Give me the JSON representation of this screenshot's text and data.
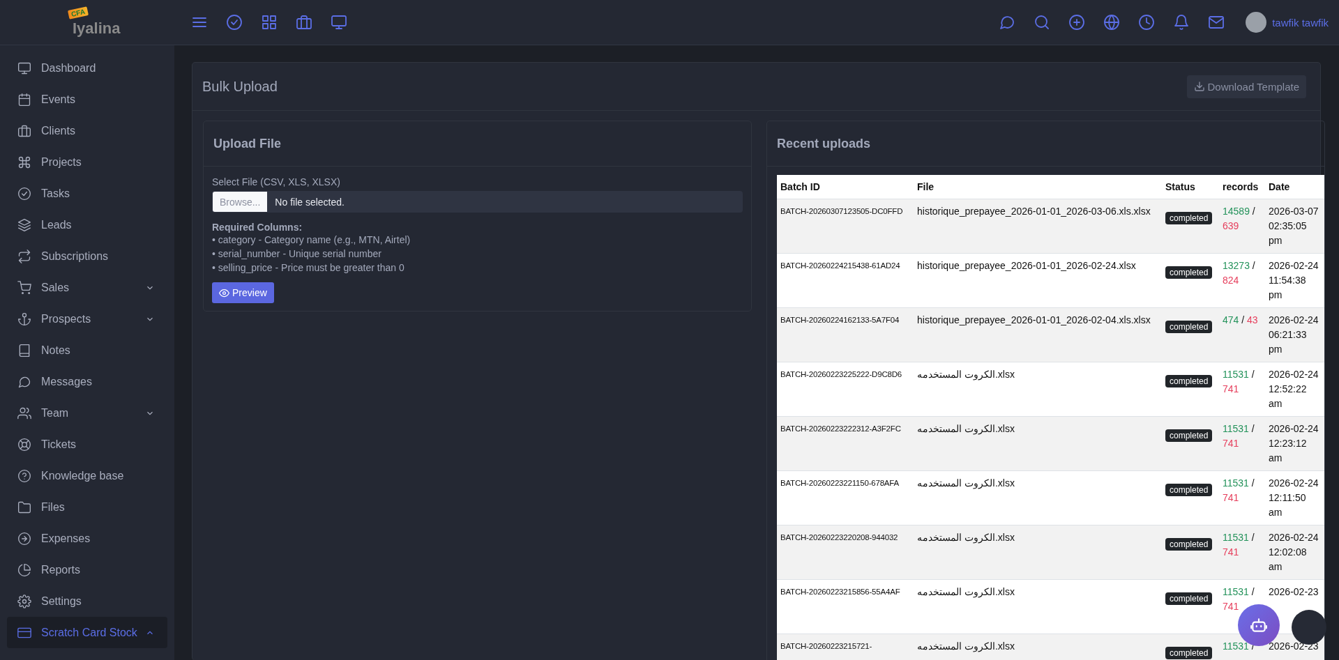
{
  "logo": {
    "badge": "CFA",
    "name": "Iyalina"
  },
  "user": {
    "name": "tawfik tawfik"
  },
  "sidebar": {
    "items": [
      {
        "label": "Dashboard",
        "kind": "link",
        "selected": false
      },
      {
        "label": "Events",
        "kind": "link",
        "selected": false
      },
      {
        "label": "Clients",
        "kind": "link",
        "selected": false
      },
      {
        "label": "Projects",
        "kind": "link",
        "selected": false
      },
      {
        "label": "Tasks",
        "kind": "link",
        "selected": false
      },
      {
        "label": "Leads",
        "kind": "link",
        "selected": false
      },
      {
        "label": "Subscriptions",
        "kind": "link",
        "selected": false
      },
      {
        "label": "Sales",
        "kind": "group",
        "selected": false,
        "expanded": false
      },
      {
        "label": "Prospects",
        "kind": "group",
        "selected": false,
        "expanded": false
      },
      {
        "label": "Notes",
        "kind": "link",
        "selected": false
      },
      {
        "label": "Messages",
        "kind": "link",
        "selected": false
      },
      {
        "label": "Team",
        "kind": "group",
        "selected": false,
        "expanded": false
      },
      {
        "label": "Tickets",
        "kind": "link",
        "selected": false
      },
      {
        "label": "Knowledge base",
        "kind": "link",
        "selected": false
      },
      {
        "label": "Files",
        "kind": "link",
        "selected": false
      },
      {
        "label": "Expenses",
        "kind": "link",
        "selected": false
      },
      {
        "label": "Reports",
        "kind": "link",
        "selected": false
      },
      {
        "label": "Settings",
        "kind": "link",
        "selected": false
      },
      {
        "label": "Scratch Card Stock",
        "kind": "group",
        "selected": true,
        "expanded": true
      }
    ]
  },
  "page": {
    "title": "Bulk Upload",
    "download_button": "Download Template"
  },
  "upload": {
    "title": "Upload File",
    "field_label": "Select File (CSV, XLS, XLSX)",
    "browse_button": "Browse...",
    "file_status": "No file selected.",
    "required_title": "Required Columns:",
    "required_lines": [
      "• category - Category name (e.g., MTN, Airtel)",
      "• serial_number - Unique serial number",
      "• selling_price - Price must be greater than 0"
    ],
    "preview_button": "Preview"
  },
  "recent": {
    "title": "Recent uploads",
    "table": {
      "columns": [
        "Batch ID",
        "File",
        "Status",
        "records",
        "Date"
      ],
      "rows": [
        {
          "batch_id": "BATCH-20260307123505-DC0FFD",
          "file": "historique_prepayee_2026-01-01_2026-03-06.xls.xlsx",
          "status": "completed",
          "records": {
            "success": "14589",
            "separator": "/",
            "failed": "639"
          },
          "date": "2026-03-07 02:35:05 pm"
        },
        {
          "batch_id": "BATCH-20260224215438-61AD24",
          "file": "historique_prepayee_2026-01-01_2026-02-24.xlsx",
          "status": "completed",
          "records": {
            "success": "13273",
            "separator": "/",
            "failed": "824"
          },
          "date": "2026-02-24 11:54:38 pm"
        },
        {
          "batch_id": "BATCH-20260224162133-5A7F04",
          "file": "historique_prepayee_2026-01-01_2026-02-04.xls.xlsx",
          "status": "completed",
          "records": {
            "success": "474",
            "separator": "/",
            "failed": "43"
          },
          "date": "2026-02-24 06:21:33 pm"
        },
        {
          "batch_id": "BATCH-20260223225222-D9C8D6",
          "file": "الكروت المستخدمه.xlsx",
          "status": "completed",
          "records": {
            "success": "11531",
            "separator": "/",
            "failed": "741"
          },
          "date": "2026-02-24 12:52:22 am"
        },
        {
          "batch_id": "BATCH-20260223222312-A3F2FC",
          "file": "الكروت المستخدمه.xlsx",
          "status": "completed",
          "records": {
            "success": "11531",
            "separator": "/",
            "failed": "741"
          },
          "date": "2026-02-24 12:23:12 am"
        },
        {
          "batch_id": "BATCH-20260223221150-678AFA",
          "file": "الكروت المستخدمه.xlsx",
          "status": "completed",
          "records": {
            "success": "11531",
            "separator": "/",
            "failed": "741"
          },
          "date": "2026-02-24 12:11:50 am"
        },
        {
          "batch_id": "BATCH-20260223220208-944032",
          "file": "الكروت المستخدمه.xlsx",
          "status": "completed",
          "records": {
            "success": "11531",
            "separator": "/",
            "failed": "741"
          },
          "date": "2026-02-24 12:02:08 am"
        },
        {
          "batch_id": "BATCH-20260223215856-55A4AF",
          "file": "الكروت المستخدمه.xlsx",
          "status": "completed",
          "records": {
            "success": "11531",
            "separator": "/",
            "failed": "741"
          },
          "date": "2026-02-23"
        },
        {
          "batch_id": "BATCH-20260223215721-",
          "file": "الكروت المستخدمه.xlsx",
          "status": "completed",
          "records": {
            "success": "11531",
            "separator": "/"
          },
          "date": "2026-02-23"
        }
      ]
    }
  }
}
